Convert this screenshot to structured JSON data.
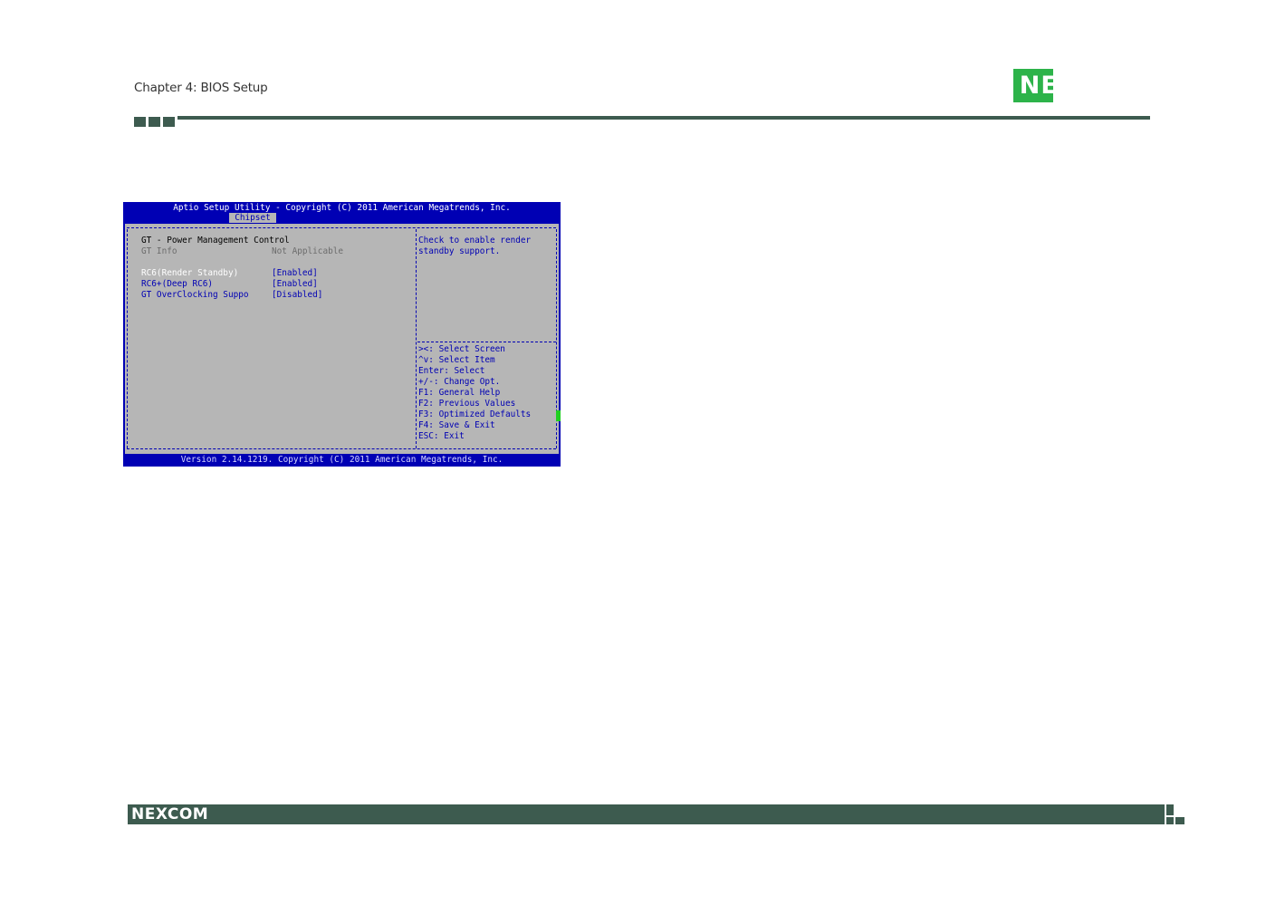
{
  "header": {
    "chapter_title": "Chapter 4: BIOS Setup",
    "logo_text": "NEXCOM"
  },
  "bios": {
    "title": "Aptio Setup Utility - Copyright (C) 2011 American Megatrends, Inc.",
    "active_tab": "Chipset",
    "section_heading": "GT - Power Management Control",
    "info_label": "GT Info",
    "info_value": "Not Applicable",
    "options": [
      {
        "label": "RC6(Render Standby)",
        "value": "[Enabled]"
      },
      {
        "label": "RC6+(Deep RC6)",
        "value": "[Enabled]"
      },
      {
        "label": "GT OverClocking Suppo",
        "value": "[Disabled]"
      }
    ],
    "help_text": [
      "Check to enable render",
      "standby support."
    ],
    "key_help": [
      "><: Select Screen",
      "^v: Select Item",
      "Enter: Select",
      "+/-: Change Opt.",
      "F1: General Help",
      "F2: Previous Values",
      "F3: Optimized Defaults",
      "F4: Save & Exit",
      "ESC: Exit"
    ],
    "version_line": "Version 2.14.1219. Copyright (C) 2011 American Megatrends, Inc."
  },
  "footer": {
    "logo_text": "NEXCOM"
  },
  "colors": {
    "bios_blue": "#0000b4",
    "bios_gray": "#b6b6b6",
    "brand_green": "#3d5b4f",
    "logo_blue": "#1b6ab4",
    "logo_green": "#2db34a"
  }
}
